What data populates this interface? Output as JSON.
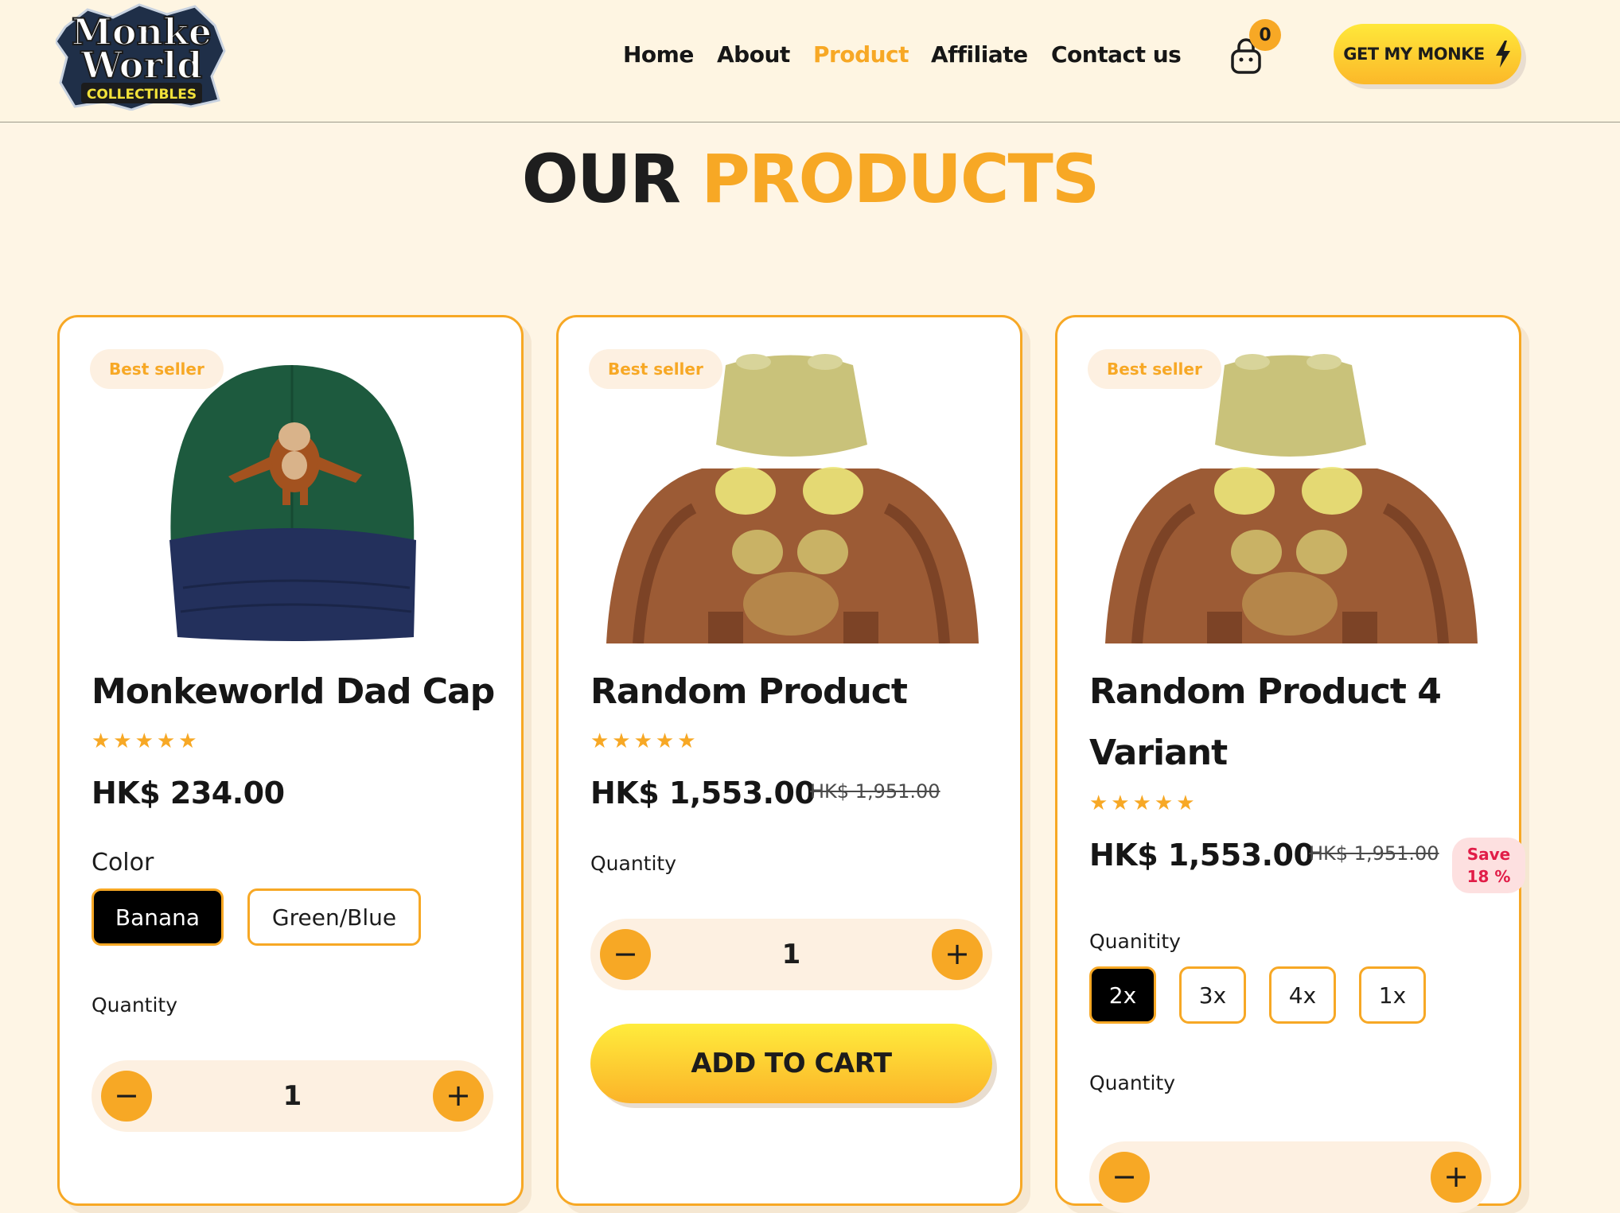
{
  "brand": {
    "line1": "Monke",
    "line2": "World",
    "tagline": "COLLECTIBLES"
  },
  "nav": [
    {
      "label": "Home",
      "active": false
    },
    {
      "label": "About",
      "active": false
    },
    {
      "label": "Product",
      "active": true
    },
    {
      "label": "Affiliate",
      "active": false
    },
    {
      "label": "Contact us",
      "active": false
    }
  ],
  "cart": {
    "count": "0",
    "icon": "shopping-bag-icon"
  },
  "cta": {
    "label": "GET MY MONKE",
    "icon": "lightning-bolt-icon"
  },
  "page": {
    "title_dark": "OUR",
    "title_accent": "PRODUCTS"
  },
  "colors": {
    "accent": "#f7a825",
    "background": "#fef5e5",
    "sale": "#e11d48"
  },
  "products": [
    {
      "badge": "Best seller",
      "name": "Monkeworld Dad Cap",
      "rating": 5,
      "stars": "★★★★★",
      "price": "HK$ 234.00",
      "color_label": "Color",
      "colors": [
        {
          "label": "Banana",
          "selected": true
        },
        {
          "label": "Green/Blue",
          "selected": false
        }
      ],
      "quantity_label": "Quantity",
      "quantity": "1"
    },
    {
      "badge": "Best seller",
      "name": "Random Product",
      "rating": 5,
      "stars": "★★★★★",
      "price": "HK$ 1,553.00",
      "old_price": "HK$ 1,951.00",
      "quantity_label": "Quantity",
      "quantity": "1",
      "add_to_cart": "ADD TO CART"
    },
    {
      "badge": "Best seller",
      "name_line1": "Random Product 4",
      "name_line2": "Variant",
      "rating": 5,
      "stars": "★★★★★",
      "price": "HK$ 1,553.00",
      "old_price": "HK$ 1,951.00",
      "save_line1": "Save",
      "save_line2": "18 %",
      "quanitity_label": "Quanitity",
      "options": [
        {
          "label": "2x",
          "selected": true
        },
        {
          "label": "3x",
          "selected": false
        },
        {
          "label": "4x",
          "selected": false
        },
        {
          "label": "1x",
          "selected": false
        }
      ],
      "quantity_label": "Quantity"
    }
  ]
}
